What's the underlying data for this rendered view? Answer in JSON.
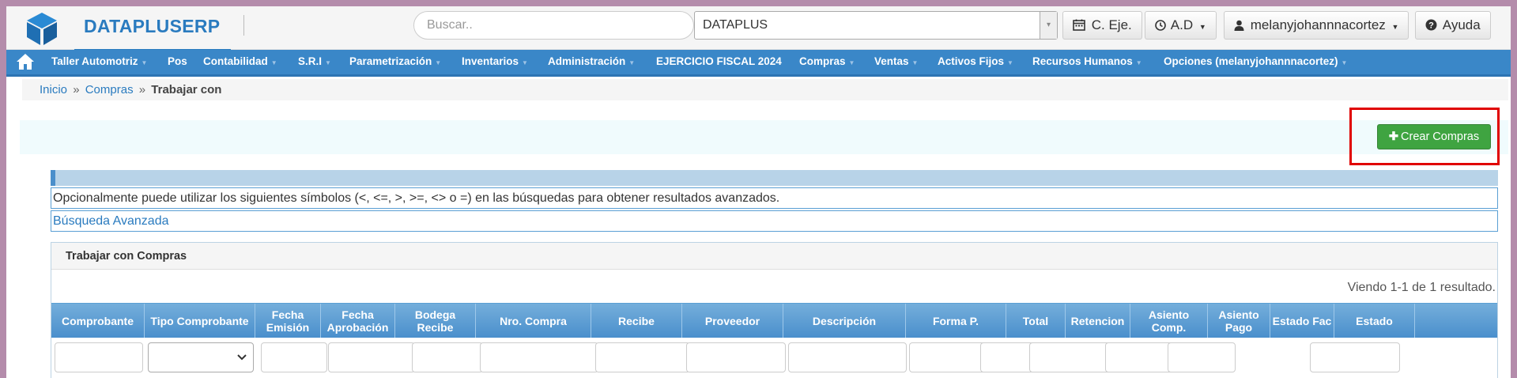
{
  "header": {
    "brand": "DATAPLUSERP",
    "search_placeholder": "Buscar..",
    "company_value": "DATAPLUS",
    "company_arrow": "▾",
    "btn_cej": "C. Eje.",
    "btn_ad": "A.D",
    "btn_user": "melanyjohannnacortez",
    "btn_help": "Ayuda"
  },
  "nav": {
    "items": [
      {
        "label": "Taller Automotriz",
        "caret": "▼"
      },
      {
        "label": "Pos",
        "caret": ""
      },
      {
        "label": "Contabilidad",
        "caret": "▼"
      },
      {
        "label": "S.R.I",
        "caret": "▼"
      },
      {
        "label": "Parametrización",
        "caret": "▼"
      },
      {
        "label": "Inventarios",
        "caret": "▼"
      },
      {
        "label": "Administración",
        "caret": "▼"
      },
      {
        "label": "EJERCICIO FISCAL 2024",
        "caret": ""
      },
      {
        "label": "Compras",
        "caret": "▼"
      },
      {
        "label": "Ventas",
        "caret": "▼"
      },
      {
        "label": "Activos Fijos",
        "caret": "▼"
      },
      {
        "label": "Recursos Humanos",
        "caret": "▼"
      },
      {
        "label": "Opciones (melanyjohannnacortez)",
        "caret": "▼"
      }
    ]
  },
  "breadcrumb": {
    "home": "Inicio",
    "sep": "»",
    "section": "Compras",
    "current": "Trabajar con"
  },
  "actions": {
    "create_label": "Crear Compras",
    "create_icon": "plus-icon"
  },
  "info": {
    "hint": "Opcionalmente puede utilizar los siguientes símbolos (<, <=, >, >=, <> o =) en las búsquedas para obtener resultados avanzados.",
    "advanced_search": "Búsqueda Avanzada"
  },
  "grid": {
    "title": "Trabajar con Compras",
    "summary": "Viendo 1-1 de 1 resultado.",
    "columns": [
      "Comprobante",
      "Tipo Comprobante",
      "Fecha Emisión",
      "Fecha Aprobación",
      "Bodega Recibe",
      "Nro. Compra",
      "Recibe",
      "Proveedor",
      "Descripción",
      "Forma P.",
      "Total",
      "Retencion",
      "Asiento Comp.",
      "Asiento Pago",
      "Estado Fac",
      "Estado"
    ]
  },
  "colors": {
    "brand": "#2a7bbf",
    "nav": "#3a87c8",
    "create_button": "#3fa441",
    "highlight": "#e00000"
  }
}
